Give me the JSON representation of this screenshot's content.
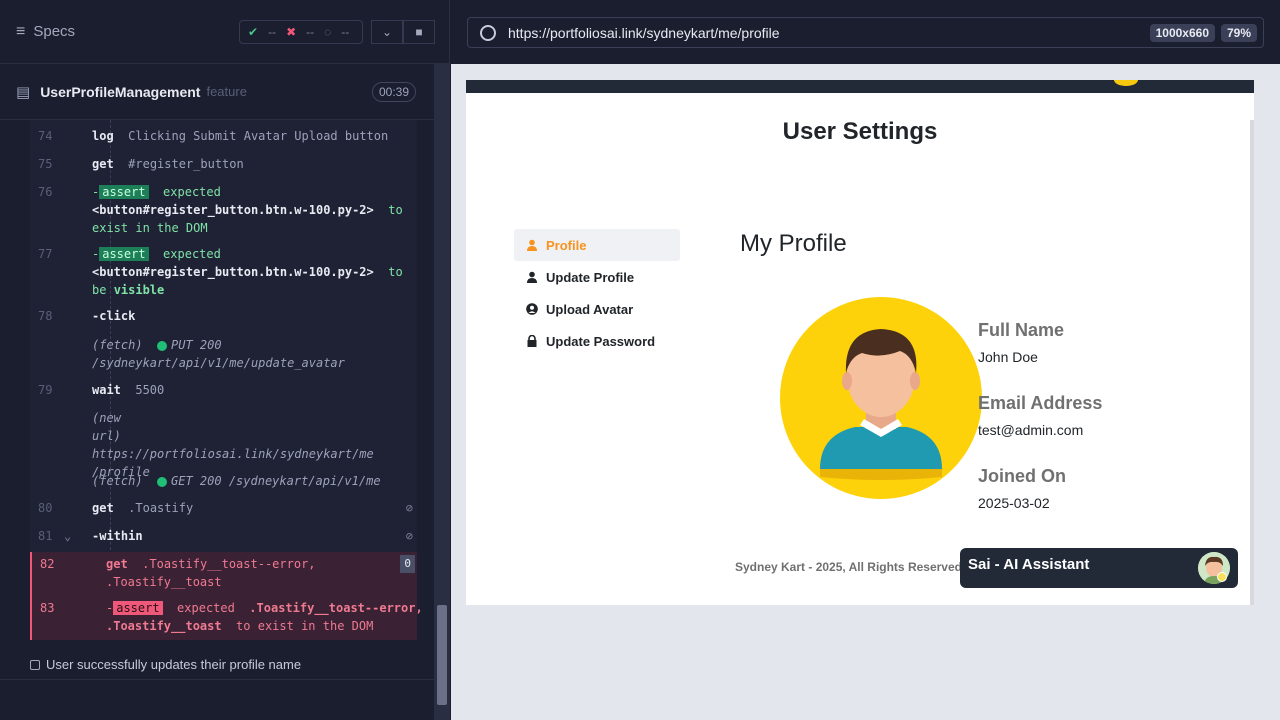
{
  "runner": {
    "specs_label": "Specs",
    "stats": {
      "passed": "--",
      "failed": "--",
      "pending": "--"
    },
    "file": {
      "name": "UserProfileManagement",
      "kind": "feature",
      "time": "00:39"
    },
    "test_title": "User successfully updates their profile name"
  },
  "commands": [
    {
      "num": "74",
      "cmd": "log",
      "text": "Clicking Submit Avatar Upload button"
    },
    {
      "num": "75",
      "cmd": "get",
      "text": "#register_button"
    },
    {
      "num": "76",
      "badge": "assert",
      "expected": "expected",
      "selector": "<button#register_button.btn.w-100.py-2>",
      "to": "to",
      "line2": "exist in the DOM"
    },
    {
      "num": "77",
      "badge": "assert",
      "expected": "expected",
      "selector": "<button#register_button.btn.w-100.py-2>",
      "to": "to",
      "line2a": "be",
      "line2b": "visible"
    },
    {
      "num": "78",
      "cmd": "-click"
    },
    {
      "fetch1_a": "(fetch)",
      "fetch1_b": "PUT 200",
      "fetch1_c": "/sydneykart/api/v1/me/update_avatar"
    },
    {
      "num": "79",
      "cmd": "wait",
      "text": "5500"
    },
    {
      "newurl_a": "(new",
      "newurl_b": "url)",
      "newurl_c": "https://portfoliosai.link/sydneykart/me",
      "newurl_d": "/profile"
    },
    {
      "fetch2_a": "(fetch)",
      "fetch2_b": "GET 200 /sydneykart/api/v1/me"
    },
    {
      "num": "80",
      "cmd": "get",
      "text": ".Toastify"
    },
    {
      "num": "81",
      "cmd": "-within"
    },
    {
      "num": "82",
      "cmd": "get",
      "text": ".Toastify__toast--error,",
      "text2": ".Toastify__toast",
      "count": "0"
    },
    {
      "num": "83",
      "badge": "assert",
      "expected": "expected",
      "text": ".Toastify__toast--error,",
      "text2": ".Toastify__toast",
      "tail": "to exist in the DOM"
    }
  ],
  "browser": {
    "url": "https://portfoliosai.link/sydneykart/me/profile",
    "viewport": "1000x660",
    "zoom": "79%"
  },
  "app": {
    "page_heading": "User Settings",
    "menu": [
      "Profile",
      "Update Profile",
      "Upload Avatar",
      "Update Password"
    ],
    "profile_title": "My Profile",
    "fields": [
      {
        "label": "Full Name",
        "value": "John Doe"
      },
      {
        "label": "Email Address",
        "value": "test@admin.com"
      },
      {
        "label": "Joined On",
        "value": "2025-03-02"
      }
    ],
    "footer": "Sydney Kart - 2025, All Rights Reserved",
    "assistant": "Sai - AI Assistant"
  },
  "colors": {
    "accent": "#f7931e",
    "pass": "#1fbf76",
    "fail": "#f0587a",
    "avatar_bg": "#fed20a"
  }
}
